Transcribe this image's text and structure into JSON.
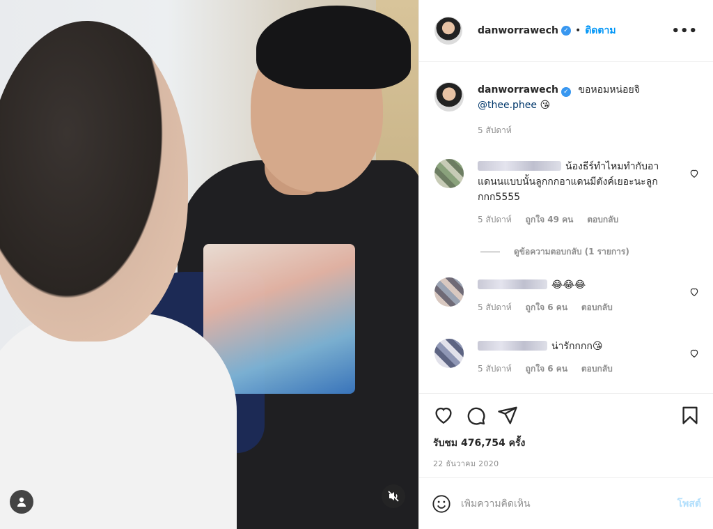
{
  "header": {
    "username": "danworrawech",
    "verified": true,
    "separator": "•",
    "follow_label": "ติดตาม",
    "more_icon": "more-horizontal-icon"
  },
  "caption": {
    "username": "danworrawech",
    "text": "ขอหอมหน่อยจิ",
    "mention": "@thee.phee",
    "emoji": "😘",
    "time": "5 สัปดาห์"
  },
  "comments": [
    {
      "text": "น้องธีร์ทำไหมทำกับอาแดนนแบบนั้นลูกกกอาแดนมีตังค์เยอะนะลูกกกก5555",
      "time": "5 สัปดาห์",
      "likes": "ถูกใจ 49 คน",
      "reply": "ตอบกลับ",
      "view_replies": "ดูข้อความตอบกลับ (1 รายการ)"
    },
    {
      "text": "😂😂😂",
      "time": "5 สัปดาห์",
      "likes": "ถูกใจ 6 คน",
      "reply": "ตอบกลับ"
    },
    {
      "text": "น่ารักกกก😘",
      "time": "5 สัปดาห์",
      "likes": "ถูกใจ 6 คน",
      "reply": "ตอบกลับ"
    }
  ],
  "actions": {
    "like_icon": "heart-icon",
    "comment_icon": "comment-icon",
    "share_icon": "share-icon",
    "save_icon": "bookmark-icon",
    "views": "รับชม 476,754 ครั้ง",
    "date": "22 ธันวาคม 2020"
  },
  "compose": {
    "emoji_icon": "smiley-icon",
    "placeholder": "เพิ่มความคิดเห็น",
    "post_label": "โพสต์"
  },
  "media": {
    "user_tag_icon": "user-tag-icon",
    "mute_icon": "muted-speaker-icon"
  },
  "colors": {
    "accent": "#0095f6",
    "verified": "#3897f0",
    "muted_text": "#8e8e8e",
    "post_disabled": "#b2dffc"
  }
}
